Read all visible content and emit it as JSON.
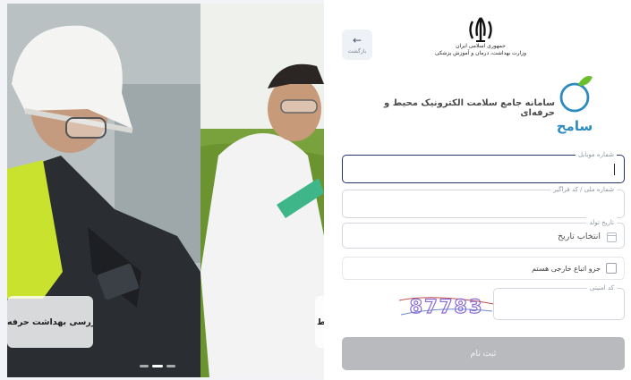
{
  "slideshow": {
    "slides": [
      {
        "caption": "بازرسی بهداشت حرفه"
      },
      {
        "caption": "ط"
      }
    ],
    "active_index": 1,
    "count": 3
  },
  "header": {
    "back_label": "بازگشت",
    "back_icon": "arrow-left-icon",
    "ministry_line1": "جمهوری اسلامی ایران",
    "ministry_line2": "وزارت بهداشت، درمان و آموزش پزشکی"
  },
  "brand": {
    "logo_text": "سامح",
    "system_title": "سامانه جامع سلامت الکترونیک محیط و حرفه‌ای",
    "logo_color": "#2e8bc0",
    "leaf_color": "#6cbf2c"
  },
  "form": {
    "mobile_label": "شماره موبایل",
    "mobile_value": "",
    "national_id_label": "شماره ملی / کد فراگیر",
    "national_id_value": "",
    "birth_date_label": "تاریخ تولد",
    "birth_date_placeholder": "انتخاب تاریخ",
    "foreign_checkbox_label": "جزو اتباع خارجی هستم",
    "foreign_checked": false,
    "captcha_label": "کد امنیتی",
    "captcha_text": "87783",
    "captcha_value": "",
    "submit_label": "ثبت نام"
  },
  "colors": {
    "focus_border": "#27346a",
    "submit_disabled": "#b8babd"
  }
}
